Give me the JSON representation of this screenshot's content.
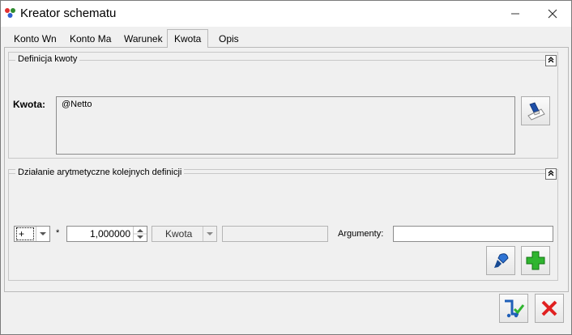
{
  "window": {
    "title": "Kreator schematu"
  },
  "titlebar_controls": {
    "minimize_icon": "minimize-icon",
    "close_icon": "close-icon"
  },
  "tabs": [
    {
      "label": "Konto Wn",
      "active": false
    },
    {
      "label": "Konto Ma",
      "active": false
    },
    {
      "label": "Warunek",
      "active": false
    },
    {
      "label": "Kwota",
      "active": true
    },
    {
      "label": "Opis",
      "active": false
    }
  ],
  "definicja": {
    "title": "Definicja kwoty",
    "kwota_label": "Kwota:",
    "kwota_value": "@Netto",
    "edit_icon": "edit-formula-icon"
  },
  "dzialanie": {
    "title": "Działanie arytmetyczne kolejnych definicji",
    "operator_value": "+",
    "multiply_sign": "*",
    "factor_value": "1,000000",
    "type_value": "Kwota",
    "extra_value": "",
    "argumenty_label": "Argumenty:",
    "argumenty_value": "",
    "pin_icon": "pin-icon",
    "add_icon": "add-icon"
  },
  "footer": {
    "save_icon": "save-icon",
    "cancel_icon": "cancel-icon"
  },
  "colors": {
    "add_green": "#2fb52f",
    "cancel_red": "#e02020",
    "pin_blue": "#1f5fb8"
  }
}
